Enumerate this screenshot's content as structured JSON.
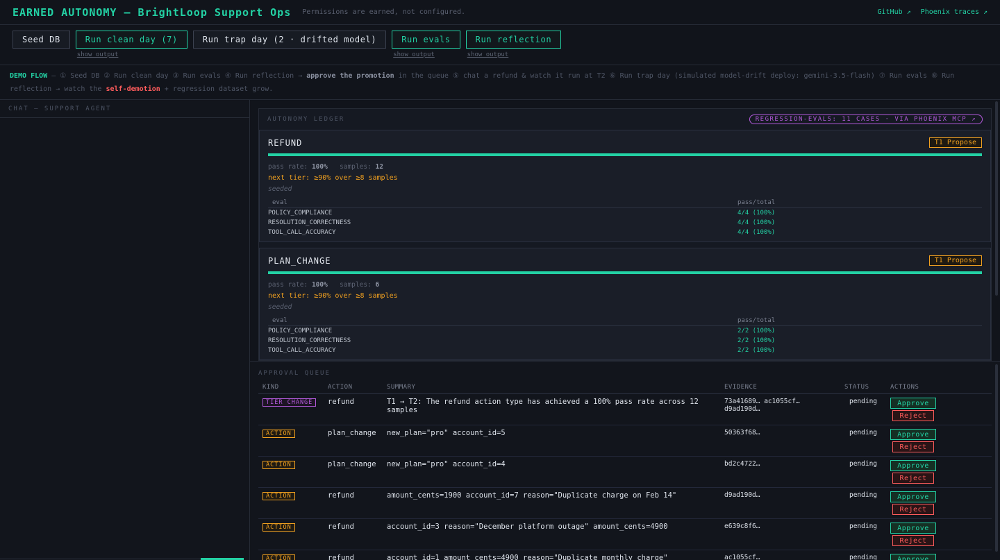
{
  "header": {
    "title": "EARNED AUTONOMY — BrightLoop Support Ops",
    "subtitle": "Permissions are earned, not configured.",
    "links": [
      "GitHub ↗",
      "Phoenix traces ↗"
    ]
  },
  "toolbar": {
    "seed": "Seed DB",
    "clean_day": "Run clean day (7)",
    "trap_day": "Run trap day (2 · drifted model)",
    "evals": "Run evals",
    "reflection": "Run reflection",
    "show_output": "show output"
  },
  "demo_flow": {
    "label": "DEMO FLOW",
    "p1": " — ① Seed DB ② Run clean day ③ Run evals ④ Run reflection → ",
    "approve": "approve the promotion",
    "p2": " in the queue ⑤ chat a refund & watch it run at T2  ⑥ Run trap day (simulated model-drift deploy: gemini-3.5-flash) ⑦ Run evals ⑧ Run reflection → watch the ",
    "demotion": "self-demotion",
    "p3": " + regression dataset grow."
  },
  "chat": {
    "title": "CHAT — SUPPORT AGENT"
  },
  "ledger": {
    "title": "AUTONOMY LEDGER",
    "regression_badge": "REGRESSION-EVALS: 11 CASES · VIA PHOENIX MCP ↗",
    "cards": [
      {
        "name": "REFUND",
        "tier": "T1 Propose",
        "pass_label": "pass rate:",
        "pass_rate": "100%",
        "samples_label": "samples:",
        "samples": "12",
        "next_tier": "next tier: ≥90% over ≥8 samples",
        "note": "seeded",
        "col_eval": "eval",
        "col_pass": "pass/total",
        "evals": [
          {
            "name": "POLICY_COMPLIANCE",
            "pass": "4/4 (100%)"
          },
          {
            "name": "RESOLUTION_CORRECTNESS",
            "pass": "4/4 (100%)"
          },
          {
            "name": "TOOL_CALL_ACCURACY",
            "pass": "4/4 (100%)"
          }
        ]
      },
      {
        "name": "PLAN_CHANGE",
        "tier": "T1 Propose",
        "pass_label": "pass rate:",
        "pass_rate": "100%",
        "samples_label": "samples:",
        "samples": "6",
        "next_tier": "next tier: ≥90% over ≥8 samples",
        "note": "seeded",
        "col_eval": "eval",
        "col_pass": "pass/total",
        "evals": [
          {
            "name": "POLICY_COMPLIANCE",
            "pass": "2/2 (100%)"
          },
          {
            "name": "RESOLUTION_CORRECTNESS",
            "pass": "2/2 (100%)"
          },
          {
            "name": "TOOL_CALL_ACCURACY",
            "pass": "2/2 (100%)"
          }
        ]
      }
    ]
  },
  "queue": {
    "title": "APPROVAL QUEUE",
    "columns": [
      "KIND",
      "ACTION",
      "SUMMARY",
      "EVIDENCE",
      "STATUS",
      "ACTIONS"
    ],
    "approve_label": "Approve",
    "reject_label": "Reject",
    "rows": [
      {
        "kind": "TIER CHANGE",
        "kind_type": "tier",
        "action": "refund",
        "summary": "T1 → T2: The refund action type has achieved a 100% pass rate across 12 samples",
        "evidence": "73a41689… ac1055cf… d9ad190d…",
        "status": "pending"
      },
      {
        "kind": "ACTION",
        "kind_type": "action",
        "action": "plan_change",
        "summary": "new_plan=\"pro\" account_id=5",
        "evidence": "50363f68…",
        "status": "pending"
      },
      {
        "kind": "ACTION",
        "kind_type": "action",
        "action": "plan_change",
        "summary": "new_plan=\"pro\" account_id=4",
        "evidence": "bd2c4722…",
        "status": "pending"
      },
      {
        "kind": "ACTION",
        "kind_type": "action",
        "action": "refund",
        "summary": "amount_cents=1900 account_id=7 reason=\"Duplicate charge on Feb 14\"",
        "evidence": "d9ad190d…",
        "status": "pending"
      },
      {
        "kind": "ACTION",
        "kind_type": "action",
        "action": "refund",
        "summary": "account_id=3 reason=\"December platform outage\" amount_cents=4900",
        "evidence": "e639c8f6…",
        "status": "pending"
      },
      {
        "kind": "ACTION",
        "kind_type": "action",
        "action": "refund",
        "summary": "account_id=1 amount_cents=4900 reason=\"Duplicate monthly charge\"",
        "evidence": "ac1055cf…",
        "status": "pending"
      }
    ]
  }
}
